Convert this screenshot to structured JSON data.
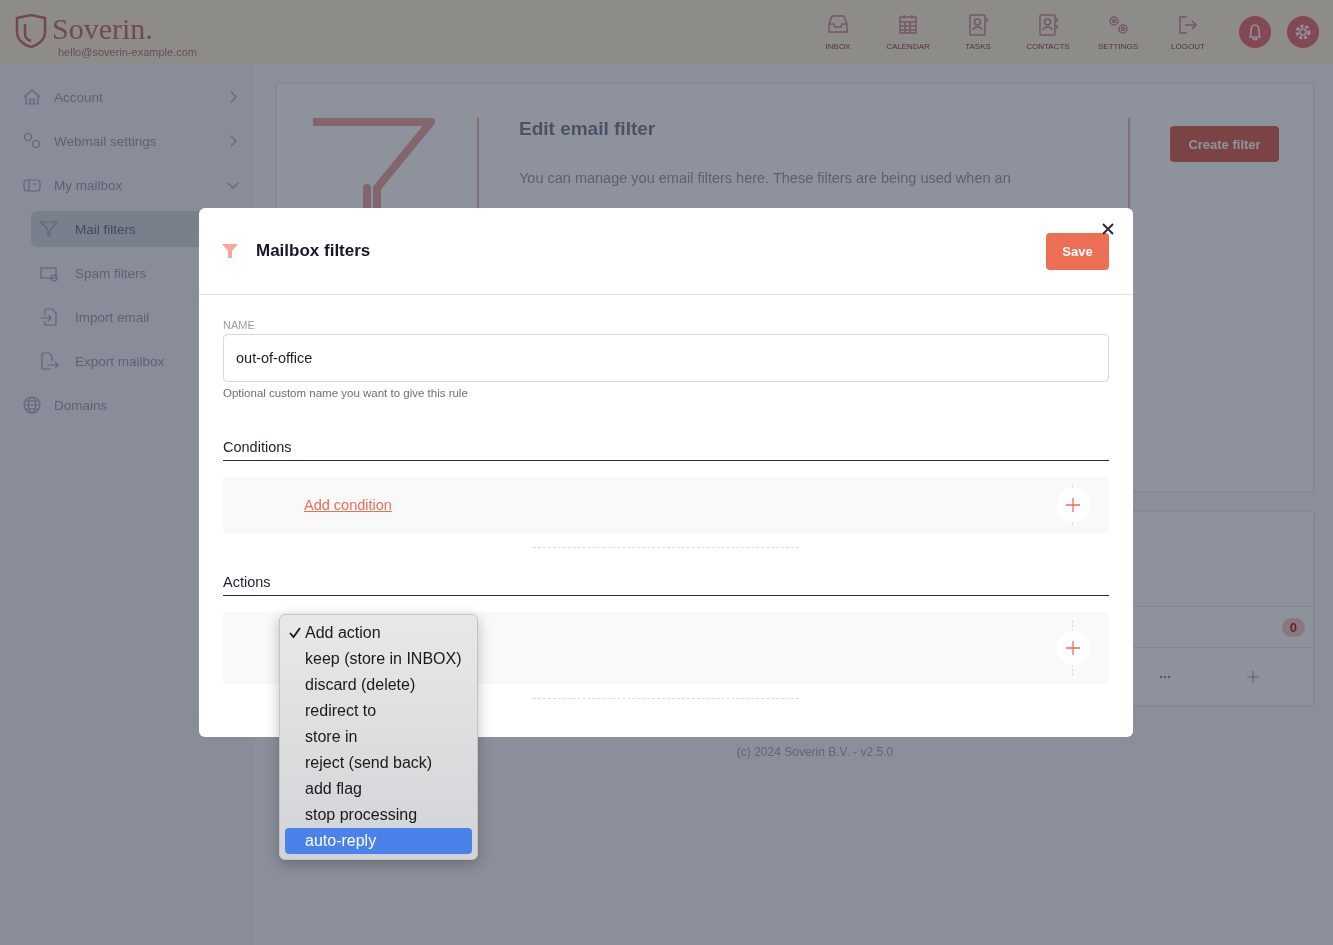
{
  "header": {
    "logo": "Soverin.",
    "email": "hello@soverin-example.com",
    "nav": [
      {
        "label": "INBOX"
      },
      {
        "label": "CALENDAR"
      },
      {
        "label": "TASKS"
      },
      {
        "label": "CONTACTS"
      },
      {
        "label": "SETTINGS"
      },
      {
        "label": "LOGOUT"
      }
    ]
  },
  "sidebar": {
    "items": [
      {
        "label": "Account",
        "kind": "group",
        "expanded": false,
        "selected": false
      },
      {
        "label": "Webmail settings",
        "kind": "group",
        "expanded": false,
        "selected": false
      },
      {
        "label": "My mailbox",
        "kind": "group",
        "expanded": true,
        "selected": false,
        "children": [
          {
            "label": "Mail filters",
            "selected": true
          },
          {
            "label": "Spam filters",
            "selected": false
          },
          {
            "label": "Import email",
            "selected": false
          },
          {
            "label": "Export mailbox",
            "selected": false
          }
        ]
      },
      {
        "label": "Domains",
        "kind": "link",
        "selected": false
      }
    ]
  },
  "page_card": {
    "title": "Edit email filter",
    "text_lines": [
      "You can manage you email filters here. These filters are being used when an"
    ],
    "button": "Create filter"
  },
  "list_card": {
    "badge": "0"
  },
  "footer": "(c) 2024 Soverin B.V. - v2.5.0",
  "modal": {
    "title": "Mailbox filters",
    "save": "Save",
    "name_field": {
      "label": "NAME",
      "value": "out-of-office",
      "hint": "Optional custom name you want to give this rule"
    },
    "sections": [
      {
        "title": "Conditions",
        "link": "Add condition"
      },
      {
        "title": "Actions"
      }
    ]
  },
  "dropdown": {
    "options": [
      {
        "label": "Add action",
        "checked": true,
        "highlighted": false
      },
      {
        "label": "keep (store in INBOX)",
        "checked": false,
        "highlighted": false
      },
      {
        "label": "discard (delete)",
        "checked": false,
        "highlighted": false
      },
      {
        "label": "redirect to",
        "checked": false,
        "highlighted": false
      },
      {
        "label": "store in",
        "checked": false,
        "highlighted": false
      },
      {
        "label": "reject (send back)",
        "checked": false,
        "highlighted": false
      },
      {
        "label": "add flag",
        "checked": false,
        "highlighted": false
      },
      {
        "label": "stop processing",
        "checked": false,
        "highlighted": false
      },
      {
        "label": "auto-reply",
        "checked": false,
        "highlighted": true
      }
    ]
  }
}
